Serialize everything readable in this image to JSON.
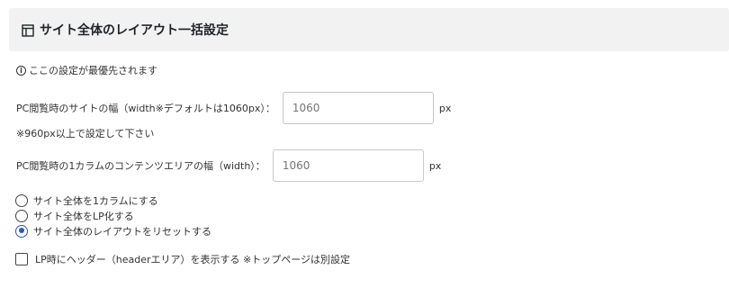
{
  "header": {
    "title": "サイト全体のレイアウト一括設定",
    "icon": "layout-icon"
  },
  "note": {
    "text": "ここの設定が最優先されます",
    "icon": "info-icon"
  },
  "site_width": {
    "label": "PC閲覧時のサイトの幅（width※デフォルトは1060px）：",
    "placeholder": "1060",
    "unit": "px",
    "note": "※960px以上で設定して下さい"
  },
  "content_width": {
    "label": "PC閲覧時の1カラムのコンテンツエリアの幅（width）：",
    "placeholder": "1060",
    "unit": "px"
  },
  "layout_options": [
    {
      "label": "サイト全体を1カラムにする",
      "checked": false
    },
    {
      "label": "サイト全体をLP化する",
      "checked": false
    },
    {
      "label": "サイト全体のレイアウトをリセットする",
      "checked": true
    }
  ],
  "header_option": {
    "label": "LP時にヘッダー（headerエリア）を表示する ※トップページは別設定",
    "checked": false
  },
  "colors": {
    "accent": "#2f56c4",
    "header_bg": "#f2f2f2"
  }
}
